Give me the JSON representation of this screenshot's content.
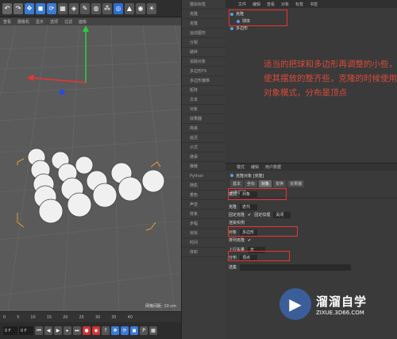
{
  "toolbar": {
    "icons": [
      "undo-icon",
      "redo-icon",
      "move-icon",
      "scale-icon",
      "rotate-icon",
      "render-icon",
      "cube-icon",
      "pen-icon",
      "subdivide-icon",
      "array-icon",
      "deform-icon",
      "scene-icon",
      "camera-icon",
      "light-icon"
    ]
  },
  "viewport": {
    "menu": [
      "查看",
      "摄像机",
      "显示",
      "选项",
      "过滤",
      "面板"
    ],
    "scale_label": "网格间距: 10 cm"
  },
  "timeline": {
    "ticks": [
      "0",
      "5",
      "10",
      "15",
      "20",
      "25",
      "30",
      "35",
      "40"
    ]
  },
  "transport": {
    "frame_start": "0 F",
    "frame_current": "0 F"
  },
  "side_strip": {
    "items": [
      "模拟标签",
      "克隆 ",
      "克隆",
      "运动图形",
      "分裂",
      "破碎",
      "追踪对象",
      "多边形FX",
      "多边形偏移",
      "矩阵",
      "文本",
      "对象",
      "效果器",
      "简易",
      "延迟",
      "公式",
      "继承",
      "推散",
      "Python",
      "随机",
      "着色",
      "声音",
      "样条",
      "步幅",
      "目标",
      "时间",
      "体积"
    ]
  },
  "object_manager": {
    "menu": [
      "文件",
      "编辑",
      "查看",
      "对象",
      "标签",
      "书签"
    ],
    "objects": [
      {
        "name": "克隆",
        "indent": 0,
        "color": "#5aa0e0"
      },
      {
        "name": "球体",
        "indent": 1,
        "color": "#5aa0e0"
      },
      {
        "name": "多边形",
        "indent": 0,
        "color": "#5aa0e0"
      }
    ]
  },
  "annotation": {
    "text": "适当的把球和多边形再调整的小些，使其摆放的整齐些，克隆的时候使用对象模式，分布是顶点"
  },
  "attribute_manager": {
    "menu": [
      "模式",
      "编辑",
      "用户数据"
    ],
    "title": "克隆对象 [克隆]",
    "tabs": [
      "基本",
      "坐标",
      "对象",
      "变换",
      "效果器"
    ],
    "active_tab": "对象",
    "section": "对象属性",
    "rows": {
      "mode_label": "模式",
      "mode_value": "对象",
      "clone_label": "克隆",
      "clone_value": "迭代",
      "fix_clone_label": "固定克隆",
      "fix_texture_label": "固定纹理",
      "fix_texture_value": "关闭",
      "render_instance_label": "渲染实例",
      "object_label": "对象",
      "object_value": "多边形",
      "arrange_label": "排列克隆",
      "upvector_label": "上行矢量",
      "upvector_value": "无",
      "distribution_label": "分布",
      "distribution_value": "顶点",
      "select_label": "选集"
    }
  },
  "watermark": {
    "title": "溜溜自学",
    "url": "ZIXUE.3D66.COM"
  },
  "colors": {
    "highlight": "#e33333",
    "annotation": "#d94a3a"
  }
}
